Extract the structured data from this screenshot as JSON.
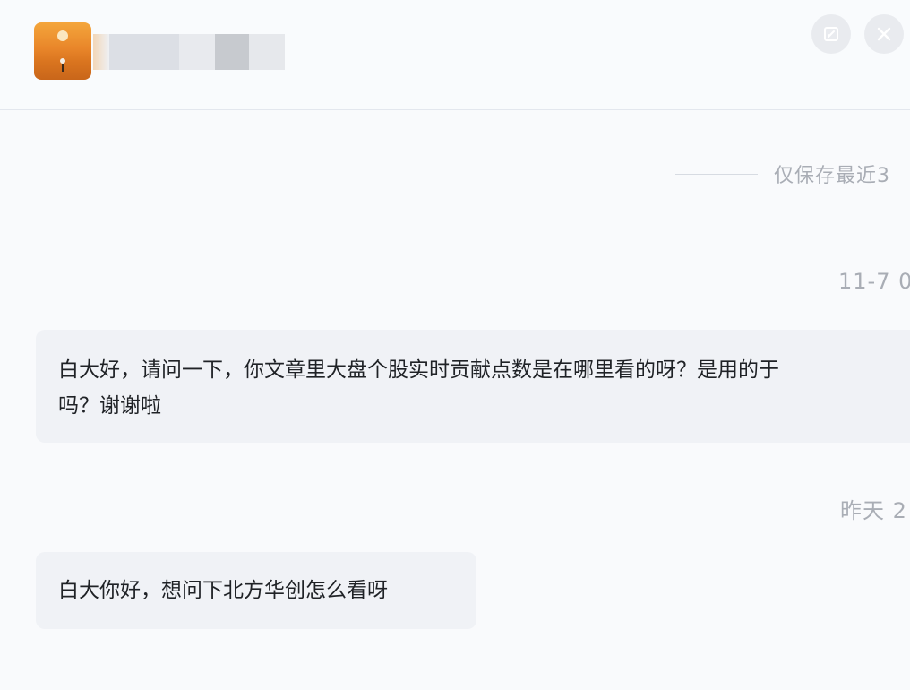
{
  "header": {
    "avatar_icon": "sunset-avatar-icon",
    "edit_icon": "edit-icon",
    "close_icon": "close-icon"
  },
  "notice": {
    "text": "仅保存最近3"
  },
  "messages": [
    {
      "timestamp": "11-7 0",
      "line1": "白大好，请问一下，你文章里大盘个股实时贡献点数是在哪里看的呀？是用的于",
      "line2": "吗？谢谢啦"
    },
    {
      "timestamp": "昨天 2",
      "line1": "白大你好，想问下北方华创怎么看呀"
    }
  ],
  "colors": {
    "background": "#f9fafc",
    "bubble": "#f0f2f6",
    "muted_text": "#a9adb5",
    "avatar_orange": "#e9862a"
  }
}
